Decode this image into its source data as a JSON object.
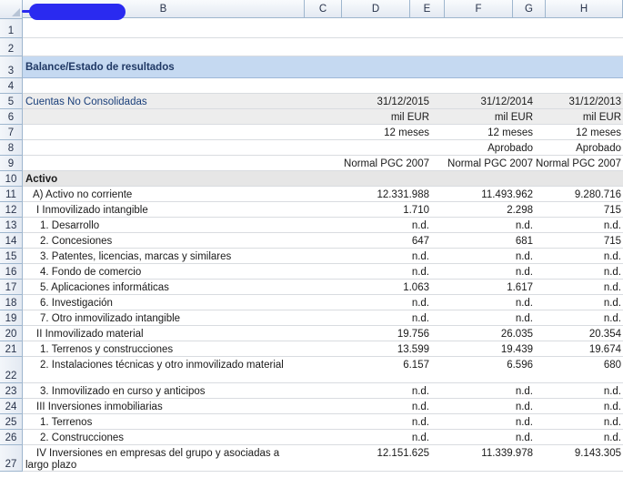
{
  "columns": [
    "B",
    "C",
    "D",
    "E",
    "F",
    "G",
    "H"
  ],
  "title": "Balance/Estado de resultados",
  "header": {
    "label": "Cuentas No Consolidadas",
    "dates": [
      "31/12/2015",
      "31/12/2014",
      "31/12/2013"
    ],
    "units": [
      "mil EUR",
      "mil EUR",
      "mil EUR"
    ],
    "periods": [
      "12 meses",
      "12 meses",
      "12 meses"
    ],
    "status": [
      "",
      "Aprobado",
      "Aprobado"
    ],
    "standard": [
      "Normal PGC 2007",
      "Normal PGC 2007",
      "Normal PGC 2007"
    ]
  },
  "section": "Activo",
  "rows": [
    {
      "n": "11",
      "label": "A) Activo no corriente",
      "v": [
        "12.331.988",
        "11.493.962",
        "9.280.716"
      ]
    },
    {
      "n": "12",
      "label": "I Inmovilizado intangible",
      "v": [
        "1.710",
        "2.298",
        "715"
      ]
    },
    {
      "n": "13",
      "label": "1. Desarrollo",
      "v": [
        "n.d.",
        "n.d.",
        "n.d."
      ]
    },
    {
      "n": "14",
      "label": "2. Concesiones",
      "v": [
        "647",
        "681",
        "715"
      ]
    },
    {
      "n": "15",
      "label": "3. Patentes, licencias, marcas y similares",
      "v": [
        "n.d.",
        "n.d.",
        "n.d."
      ]
    },
    {
      "n": "16",
      "label": "4. Fondo de comercio",
      "v": [
        "n.d.",
        "n.d.",
        "n.d."
      ]
    },
    {
      "n": "17",
      "label": "5. Aplicaciones informáticas",
      "v": [
        "1.063",
        "1.617",
        "n.d."
      ]
    },
    {
      "n": "18",
      "label": "6. Investigación",
      "v": [
        "n.d.",
        "n.d.",
        "n.d."
      ]
    },
    {
      "n": "19",
      "label": "7. Otro inmovilizado intangible",
      "v": [
        "n.d.",
        "n.d.",
        "n.d."
      ]
    },
    {
      "n": "20",
      "label": "II Inmovilizado material",
      "v": [
        "19.756",
        "26.035",
        "20.354"
      ]
    },
    {
      "n": "21",
      "label": "1. Terrenos y construcciones",
      "v": [
        "13.599",
        "19.439",
        "19.674"
      ]
    },
    {
      "n": "22",
      "label": "2. Instalaciones técnicas y otro inmovilizado material",
      "v": [
        "6.157",
        "6.596",
        "680"
      ]
    },
    {
      "n": "23",
      "label": "3. Inmovilizado en curso y anticipos",
      "v": [
        "n.d.",
        "n.d.",
        "n.d."
      ]
    },
    {
      "n": "24",
      "label": "III Inversiones inmobiliarias",
      "v": [
        "n.d.",
        "n.d.",
        "n.d."
      ]
    },
    {
      "n": "25",
      "label": "1. Terrenos",
      "v": [
        "n.d.",
        "n.d.",
        "n.d."
      ]
    },
    {
      "n": "26",
      "label": "2. Construcciones",
      "v": [
        "n.d.",
        "n.d.",
        "n.d."
      ]
    },
    {
      "n": "27",
      "label": "IV Inversiones en empresas del grupo y asociadas a largo plazo",
      "v": [
        "12.151.625",
        "11.339.978",
        "9.143.305"
      ]
    }
  ]
}
